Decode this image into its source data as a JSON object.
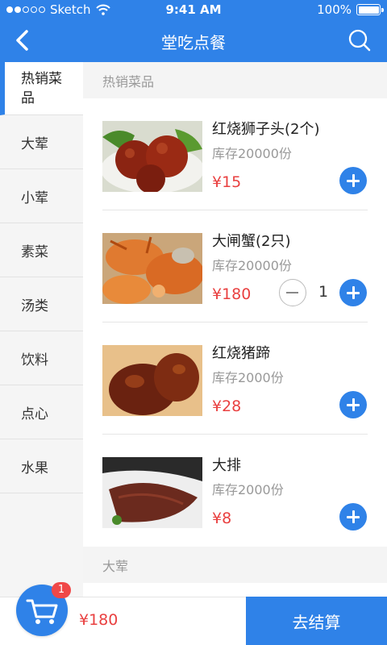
{
  "status_bar": {
    "carrier": "Sketch",
    "time": "9:41 AM",
    "battery": "100%"
  },
  "nav": {
    "title": "堂吃点餐",
    "back_icon": "chevron-left-icon",
    "search_icon": "search-icon"
  },
  "sidebar": {
    "items": [
      {
        "label": "热销菜品"
      },
      {
        "label": "大荤"
      },
      {
        "label": "小荤"
      },
      {
        "label": "素菜"
      },
      {
        "label": "汤类"
      },
      {
        "label": "饮料"
      },
      {
        "label": "点心"
      },
      {
        "label": "水果"
      }
    ]
  },
  "main": {
    "section1": "热销菜品",
    "items": [
      {
        "name": "红烧狮子头(2个)",
        "stock": "库存20000份",
        "price": "¥15"
      },
      {
        "name": "大闸蟹(2只)",
        "stock": "库存20000份",
        "price": "¥180",
        "quantity": "1"
      },
      {
        "name": "红烧猪蹄",
        "stock": "库存2000份",
        "price": "¥28"
      },
      {
        "name": "大排",
        "stock": "库存2000份",
        "price": "¥8"
      }
    ],
    "section2": "大荤"
  },
  "bottom": {
    "cart_badge": "1",
    "total": "¥180",
    "checkout": "去结算"
  },
  "colors": {
    "primary": "#2f82e8",
    "price": "#e94040",
    "badge": "#f04848"
  }
}
